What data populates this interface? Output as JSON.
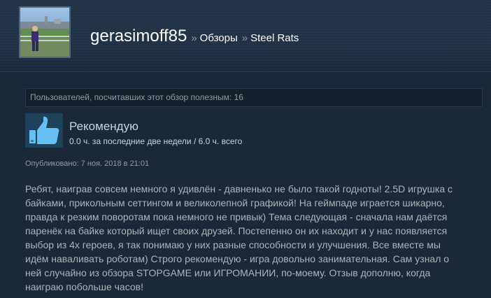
{
  "breadcrumb": {
    "user": "gerasimoff85",
    "separator": "»",
    "section": "Обзоры",
    "game": "Steel Rats"
  },
  "review": {
    "helpful_text": "Пользователей, посчитавших этот обзор полезным: 16",
    "recommendation": "Рекомендую",
    "hours": "0.0 ч. за последние две недели / 6.0 ч. всего",
    "posted": "Опубликовано: 7 ноя. 2018 в 21:01",
    "lines": [
      "Ребят, наиграв совсем немного я удивлён - давненько не было такой годноты! 2.5D игрушка с",
      "байками, прикольным сеттингом и великолепной графикой! На геймпаде играется шикарно,",
      "правда к резким поворотам пока немного не привык) Тема следующая - сначала нам даётся",
      "паренёк на байке который ищет своих друзей. Постепенно он их находит и у нас появляется",
      "выбор из 4х героев, я так понимаю у них разные способности и улучшения. Все вместе мы",
      "идём наваливать роботам) Строго рекомендую - игра довольно занимательная. Сам узнал о",
      "ней случайно из обзора STOPGAME или ИГРОМАНИИ, по-моему. Отзыв дополню, когда",
      "наиграю побольше часов!"
    ]
  },
  "icons": {
    "recommend": "thumbs-up-icon",
    "avatar": "avatar"
  },
  "colors": {
    "background": "#1b2838",
    "header": "#223146",
    "thumb_box": "#1e425a",
    "thumb": "#66c0f4",
    "text": "#acb2b8"
  }
}
